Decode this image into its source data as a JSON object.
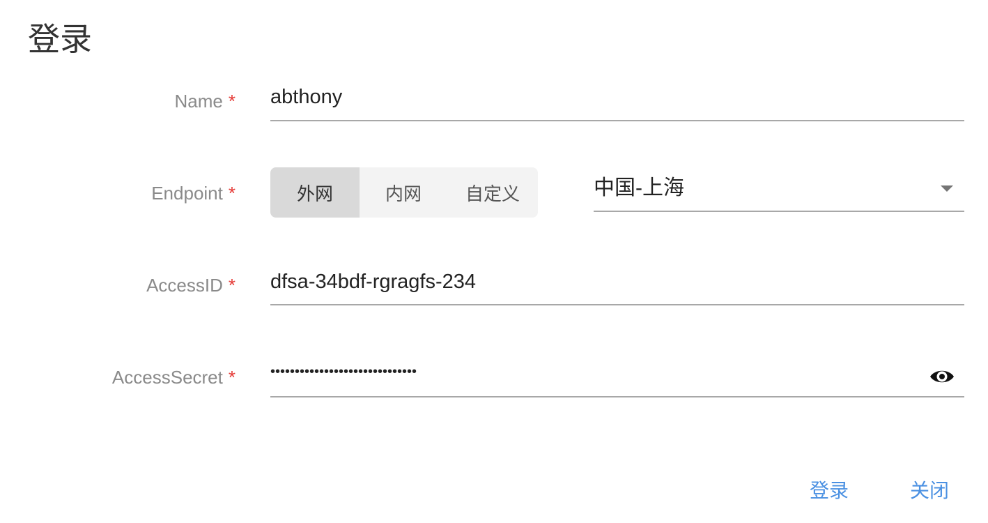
{
  "dialog": {
    "title": "登录"
  },
  "form": {
    "name": {
      "label": "Name",
      "required_mark": "*",
      "value": "abthony"
    },
    "endpoint": {
      "label": "Endpoint",
      "required_mark": "*",
      "options": [
        "外网",
        "内网",
        "自定义"
      ],
      "selected_option": "外网",
      "region_value": "中国-上海"
    },
    "access_id": {
      "label": "AccessID",
      "required_mark": "*",
      "value": "dfsa-34bdf-rgragfs-234"
    },
    "access_secret": {
      "label": "AccessSecret",
      "required_mark": "*",
      "masked_value": "••••••••••••••••••••••••••••••",
      "toggle_icon": "eye-icon"
    }
  },
  "actions": {
    "login_label": "登录",
    "close_label": "关闭"
  },
  "colors": {
    "accent": "#4a90e2",
    "required": "#e53935",
    "label": "#8a8a8a",
    "segment_active_bg": "#d9d9d9",
    "segment_bg": "#f3f3f3"
  }
}
